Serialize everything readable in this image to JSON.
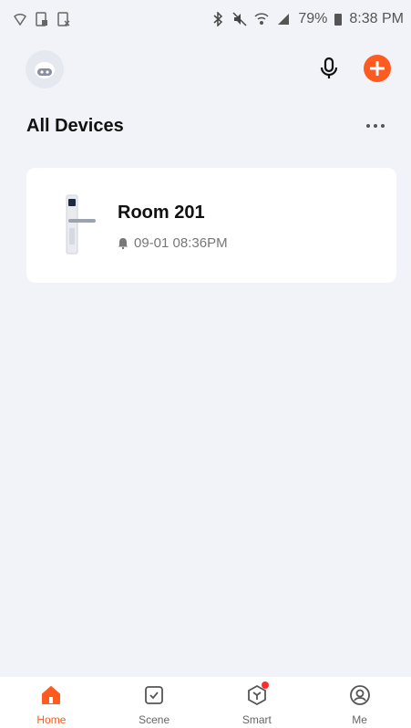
{
  "status_bar": {
    "battery_percent": "79%",
    "time": "8:38 PM",
    "left_icons": [
      "wifi-shield-icon",
      "device-lock-icon",
      "screenshot-icon"
    ],
    "right_icons": [
      "bluetooth-icon",
      "mute-icon",
      "wifi-icon",
      "signal-icon",
      "battery-icon"
    ]
  },
  "header": {
    "avatar_icon": "robot-avatar-icon",
    "mic_icon": "microphone-icon",
    "add_icon": "plus-icon"
  },
  "section": {
    "title": "All Devices",
    "more_icon": "more-dots-icon"
  },
  "devices": [
    {
      "name": "Room 201",
      "timestamp": "09-01 08:36PM",
      "status_icon": "bell-icon",
      "image": "door-lock-image"
    }
  ],
  "tabbar": {
    "tabs": [
      {
        "label": "Home",
        "icon": "home-icon",
        "active": true
      },
      {
        "label": "Scene",
        "icon": "scene-check-icon",
        "active": false
      },
      {
        "label": "Smart",
        "icon": "smart-cube-icon",
        "active": false
      },
      {
        "label": "Me",
        "icon": "profile-icon",
        "active": false
      }
    ]
  },
  "colors": {
    "accent": "#ff5a1f",
    "background": "#f2f3f8",
    "card": "#ffffff",
    "badge": "#ff2d2d"
  }
}
